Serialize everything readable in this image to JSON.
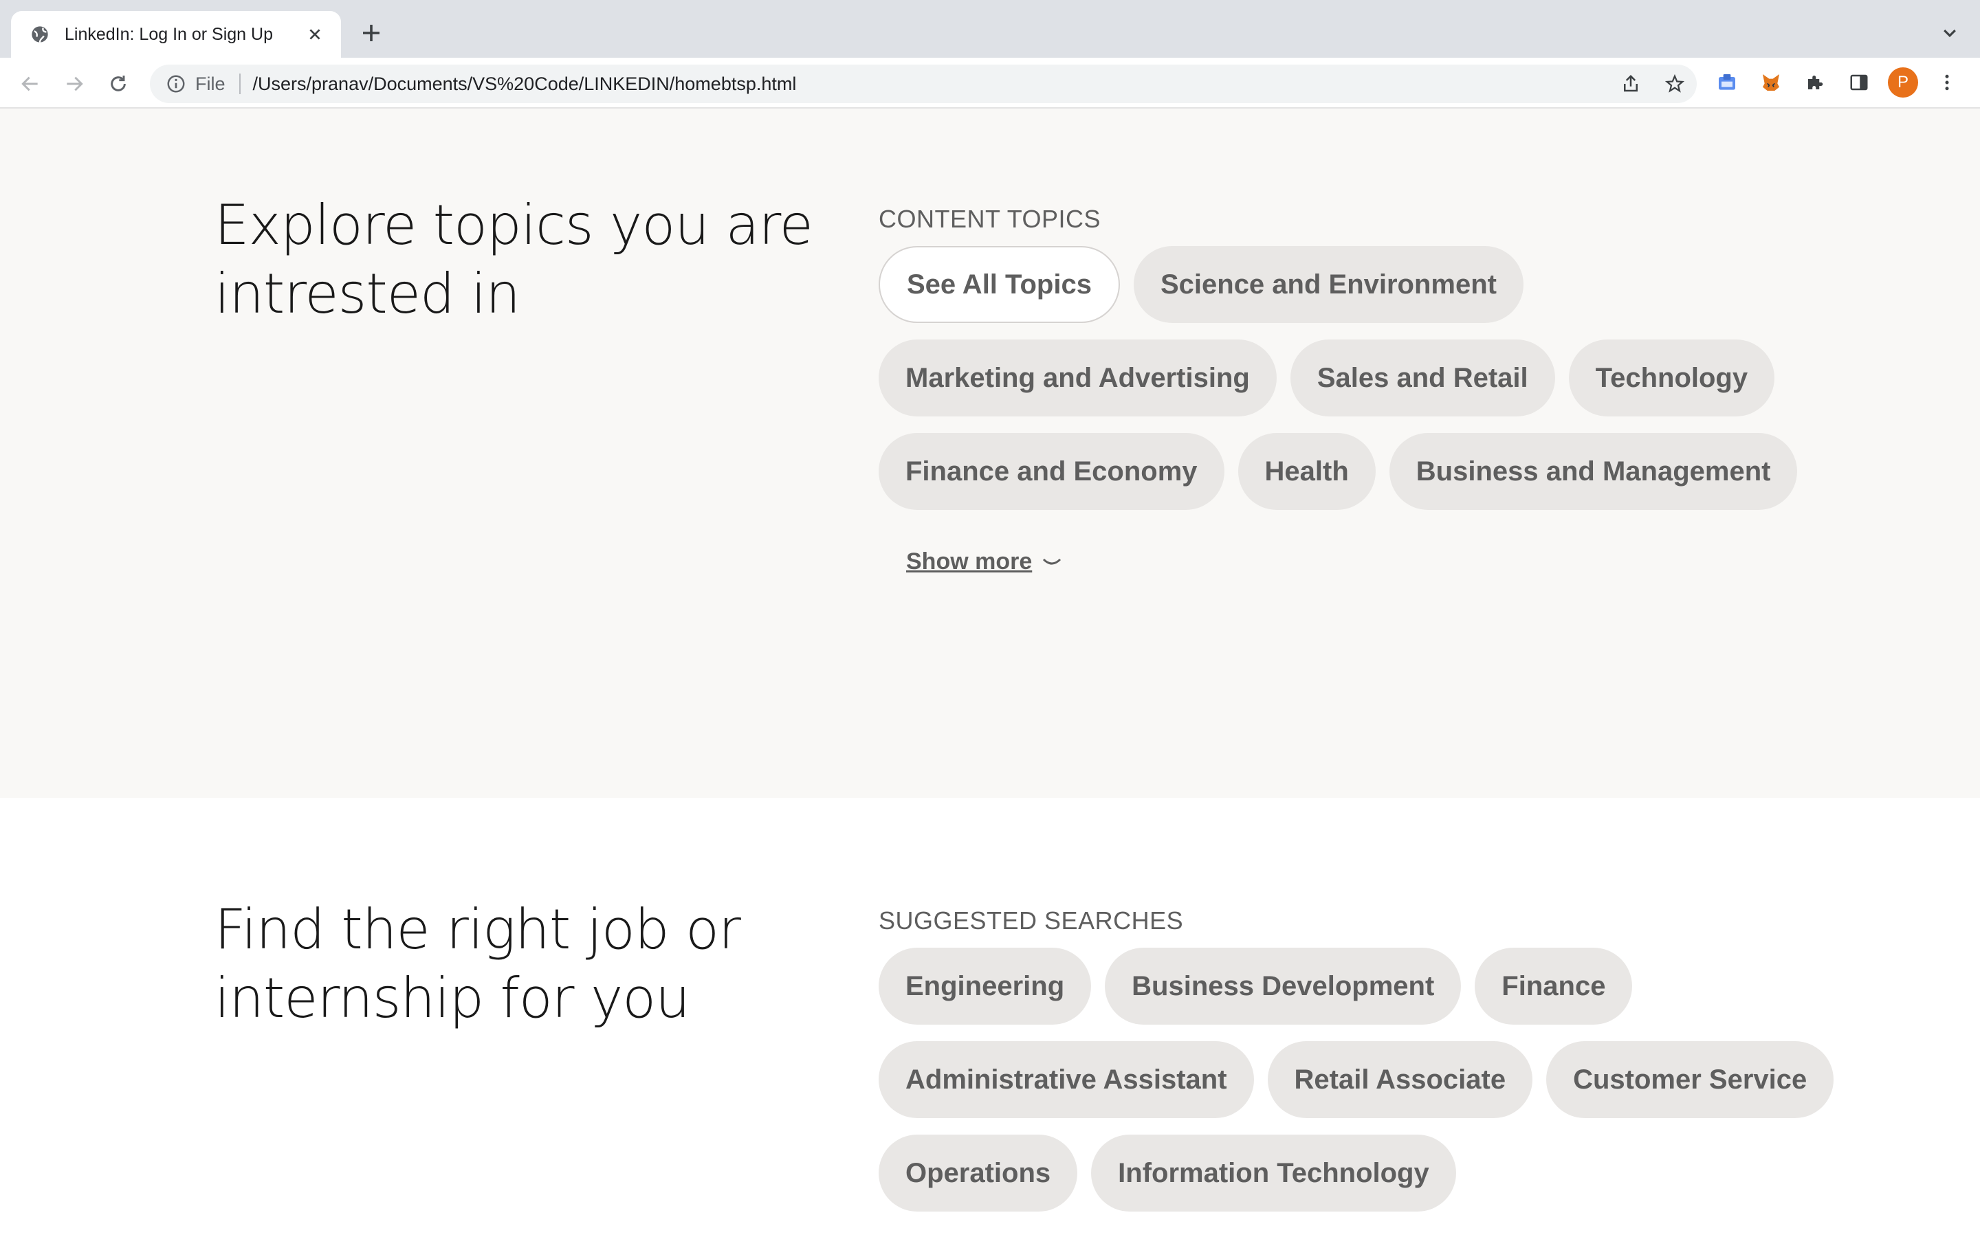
{
  "browser": {
    "tab_title": "LinkedIn: Log In or Sign Up",
    "omnibox_scheme": "File",
    "url": "/Users/pranav/Documents/VS%20Code/LINKEDIN/homebtsp.html",
    "profile_initial": "P"
  },
  "topics": {
    "heading": "Explore topics you are intrested in",
    "label": "CONTENT TOPICS",
    "pills": [
      "See All Topics",
      "Science and Environment",
      "Marketing and Advertising",
      "Sales and Retail",
      "Technology",
      "Finance and Economy",
      "Health",
      "Business and Management"
    ],
    "show_more": "Show more"
  },
  "jobs": {
    "heading": "Find the right job or internship for you",
    "label": "SUGGESTED SEARCHES",
    "pills": [
      "Engineering",
      "Business Development",
      "Finance",
      "Administrative Assistant",
      "Retail Associate",
      "Customer Service",
      "Operations",
      "Information Technology"
    ]
  }
}
